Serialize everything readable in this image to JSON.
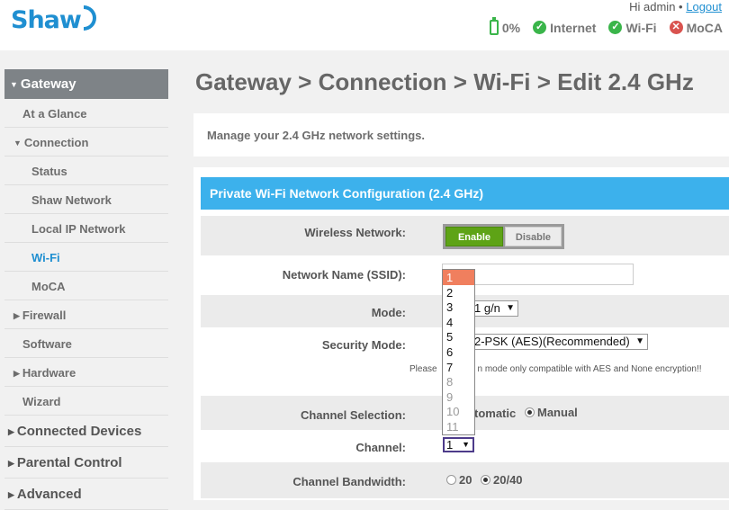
{
  "header": {
    "brand": "Shaw",
    "greeting": "Hi admin",
    "separator": "•",
    "logout": "Logout",
    "status": [
      {
        "label": "0%",
        "icon": "battery-icon"
      },
      {
        "label": "Internet",
        "icon": "check-icon"
      },
      {
        "label": "Wi-Fi",
        "icon": "check-icon"
      },
      {
        "label": "MoCA",
        "icon": "x-icon"
      }
    ]
  },
  "sidebar": {
    "gateway": "Gateway",
    "items": [
      "At a Glance",
      "Connection",
      "Status",
      "Shaw Network",
      "Local IP Network",
      "Wi-Fi",
      "MoCA",
      "Firewall",
      "Software",
      "Hardware",
      "Wizard"
    ],
    "sections": [
      "Connected Devices",
      "Parental Control",
      "Advanced"
    ]
  },
  "page": {
    "title": "Gateway > Connection > Wi-Fi > Edit 2.4 GHz",
    "description": "Manage your 2.4 GHz network settings.",
    "panel_title": "Private Wi-Fi Network Configuration (2.4 GHz)"
  },
  "form": {
    "wireless_label": "Wireless Network:",
    "enable": "Enable",
    "disable": "Disable",
    "ssid_label": "Network Name (SSID):",
    "ssid_value": "",
    "mode_label": "Mode:",
    "mode_value": "1 g/n",
    "security_label": "Security Mode:",
    "security_value": "2-PSK (AES)(Recommended)",
    "note_left": "Please",
    "note_right": "1.11 n mode only compatible with AES and None encryption!!",
    "channel_sel_label": "Channel Selection:",
    "automatic": "tomatic",
    "manual": "Manual",
    "channel_label": "Channel:",
    "channel_value": "1",
    "bandwidth_label": "Channel Bandwidth:",
    "bw_20": "20",
    "bw_2040": "20/40"
  },
  "channel_options": [
    "1",
    "2",
    "3",
    "4",
    "5",
    "6",
    "7",
    "8",
    "9",
    "10",
    "11"
  ]
}
